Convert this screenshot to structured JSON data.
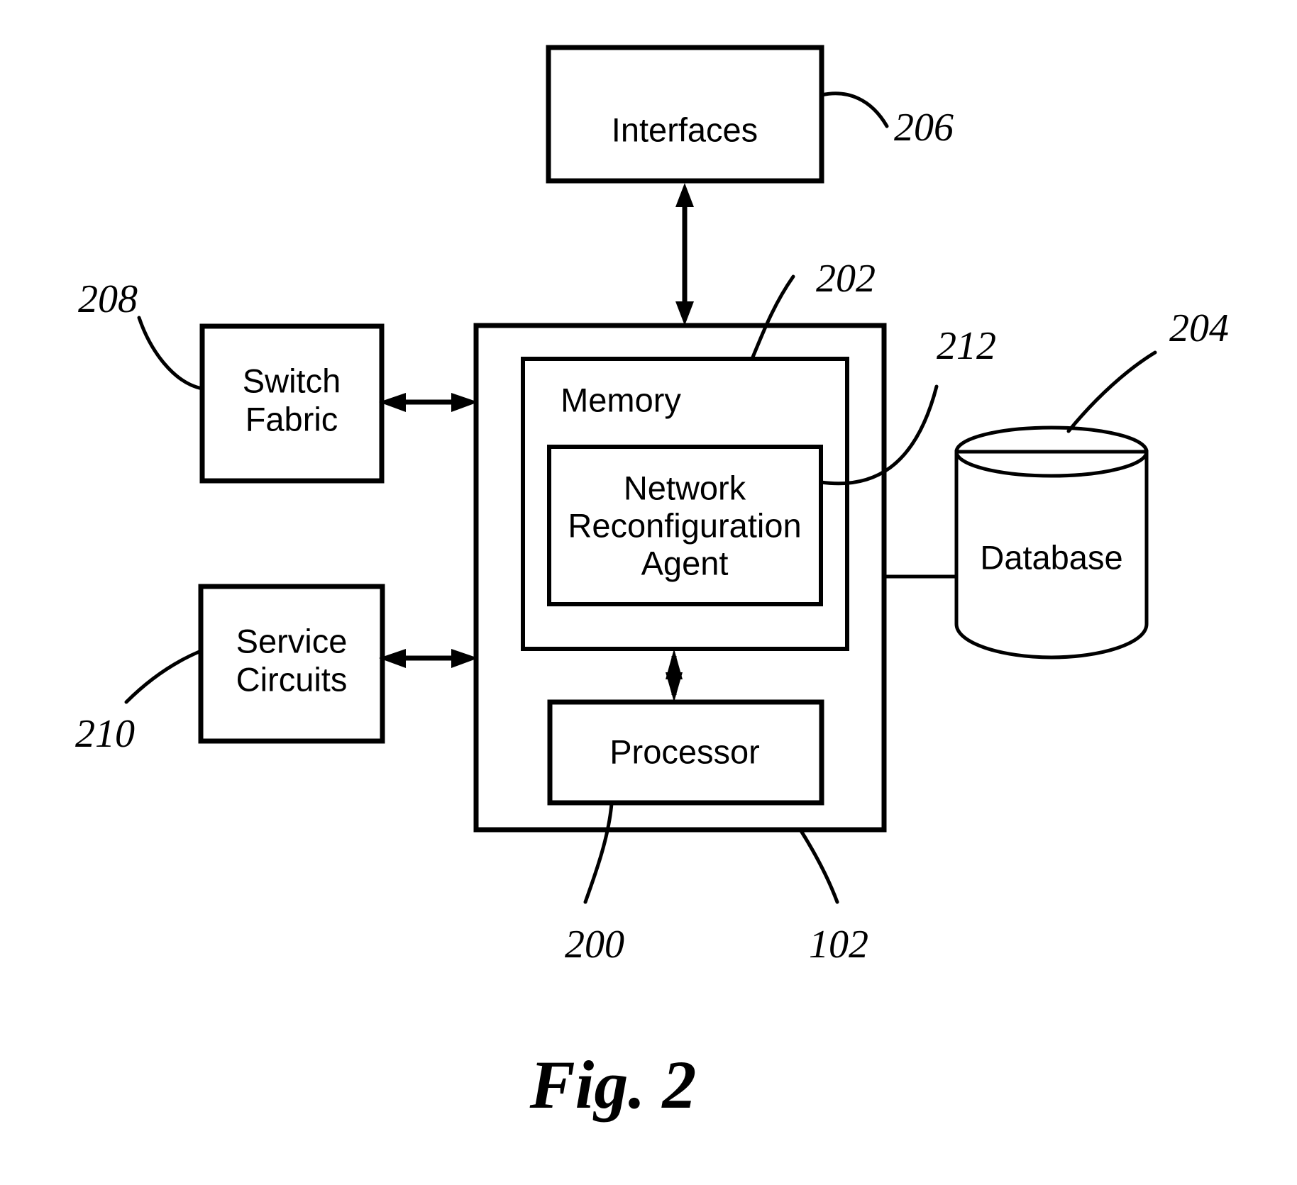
{
  "figure": {
    "caption": "Fig. 2",
    "type": "patent-block-diagram"
  },
  "blocks": {
    "interfaces": {
      "label": "Interfaces",
      "ref": "206"
    },
    "switch_fabric": {
      "label": "Switch\nFabric",
      "line1": "Switch",
      "line2": "Fabric",
      "ref": "208"
    },
    "service_circuits": {
      "label": "Service\nCircuits",
      "line1": "Service",
      "line2": "Circuits",
      "ref": "210"
    },
    "memory": {
      "label": "Memory",
      "ref": "202"
    },
    "network_reconfiguration_agent": {
      "line1": "Network",
      "line2": "Reconfiguration",
      "line3": "Agent",
      "ref": "212"
    },
    "processor": {
      "label": "Processor",
      "ref": "200"
    },
    "database": {
      "label": "Database",
      "ref": "204"
    },
    "node": {
      "ref": "102"
    }
  },
  "reference_numerals": {
    "n200": "200",
    "n202": "202",
    "n204": "204",
    "n206": "206",
    "n208": "208",
    "n210": "210",
    "n212": "212",
    "n102": "102"
  },
  "connections": [
    {
      "from": "interfaces",
      "to": "node",
      "style": "double-arrow-vertical"
    },
    {
      "from": "switch_fabric",
      "to": "node",
      "style": "double-arrow-horizontal"
    },
    {
      "from": "service_circuits",
      "to": "node",
      "style": "double-arrow-horizontal"
    },
    {
      "from": "memory",
      "to": "processor",
      "style": "double-arrow-vertical"
    },
    {
      "from": "node",
      "to": "database",
      "style": "plain-line"
    }
  ],
  "colors": {
    "stroke": "#000000",
    "background": "#ffffff"
  }
}
